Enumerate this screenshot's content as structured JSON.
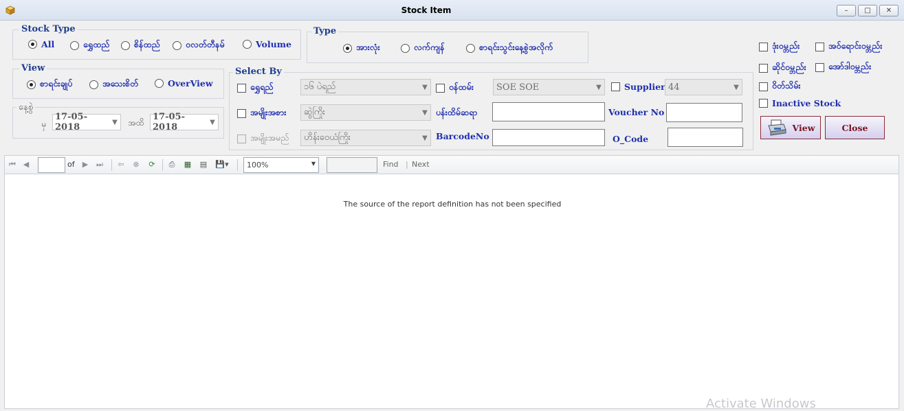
{
  "window": {
    "title": "Stock Item",
    "minimize_glyph": "–",
    "maximize_glyph": "□",
    "close_glyph": "✕"
  },
  "stock_type": {
    "title": "Stock Type",
    "options": [
      "All",
      "ရွှေထည်",
      "စိန်ထည်",
      "ဝလတ်တီနမ်",
      "Volume"
    ],
    "selected": "All"
  },
  "type_group": {
    "title": "Type",
    "options": [
      "အားလုံး",
      "လက်ကျန်",
      "စာရင်းသွင်းနေ့စွဲအလိုက်"
    ],
    "selected": "အားလုံး"
  },
  "view_group": {
    "title": "View",
    "options": [
      "စာရင်းချုပ်",
      "အသေးစိတ်",
      "OverView"
    ],
    "selected": "စာရင်းချုပ်"
  },
  "date_group": {
    "title": "နေ့စွဲ",
    "from_label": "မှ",
    "from_value": "17-05-2018",
    "to_label": "အထိ",
    "to_value": "17-05-2018"
  },
  "select_by": {
    "title": "Select By",
    "gold_label": "ရွှေရည်",
    "gold_value": "၁၆ ပဲရည်",
    "staff_label": "ဝန်ထမ်း",
    "staff_value": "SOE SOE",
    "supplier_label": "Supplier",
    "supplier_value": "44",
    "item_type_label": "အမျိုးအစား",
    "item_type_value": "ဆွဲကြိုး",
    "product_no_label": "ပန်းထိမ်ဆရာ",
    "voucher_label": "Voucher No",
    "item_name_label": "အမျိုးအမည်",
    "item_name_value": "ဟိန်းဝေယံကြိုး",
    "barcode_label": "BarcodeNo",
    "ocode_label": "O_Code"
  },
  "right_checks": [
    "ဒုံးဝမ္ဘည်း",
    "အဝ်ရောင်းဝမ္ဘည်း",
    "ဆိုင်ဝမ္ဘည်း",
    "အော်ဒါဝမ္ဘည်း",
    "ဝိတ်သိမ်း",
    "Inactive Stock"
  ],
  "buttons": {
    "view": "View",
    "close": "Close"
  },
  "report_toolbar": {
    "of_label": "of",
    "zoom": "100%",
    "find": "Find",
    "separator": "|",
    "next": "Next"
  },
  "report": {
    "message": "The source of the report definition has not been specified"
  },
  "watermark": "Activate Windows"
}
